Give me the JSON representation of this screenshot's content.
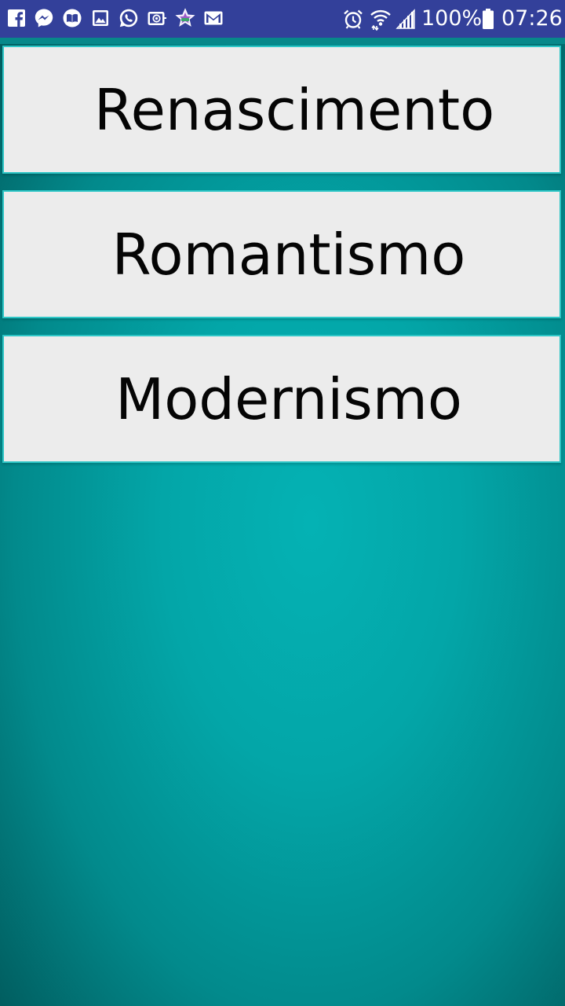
{
  "status_bar": {
    "notification_icons": [
      "facebook-icon",
      "messenger-icon",
      "reader-icon",
      "gallery-icon",
      "whatsapp-icon",
      "email-icon",
      "star-app-icon",
      "gmail-icon"
    ],
    "battery_percent": "100%",
    "time": "07:26",
    "background_color": "#33409a"
  },
  "menu": {
    "items": [
      {
        "label": "Renascimento"
      },
      {
        "label": "Romantismo"
      },
      {
        "label": "Modernismo"
      }
    ]
  },
  "colors": {
    "button_background": "#ececec",
    "button_border": "#2dc6c6",
    "background_teal": "#03a6a8"
  }
}
